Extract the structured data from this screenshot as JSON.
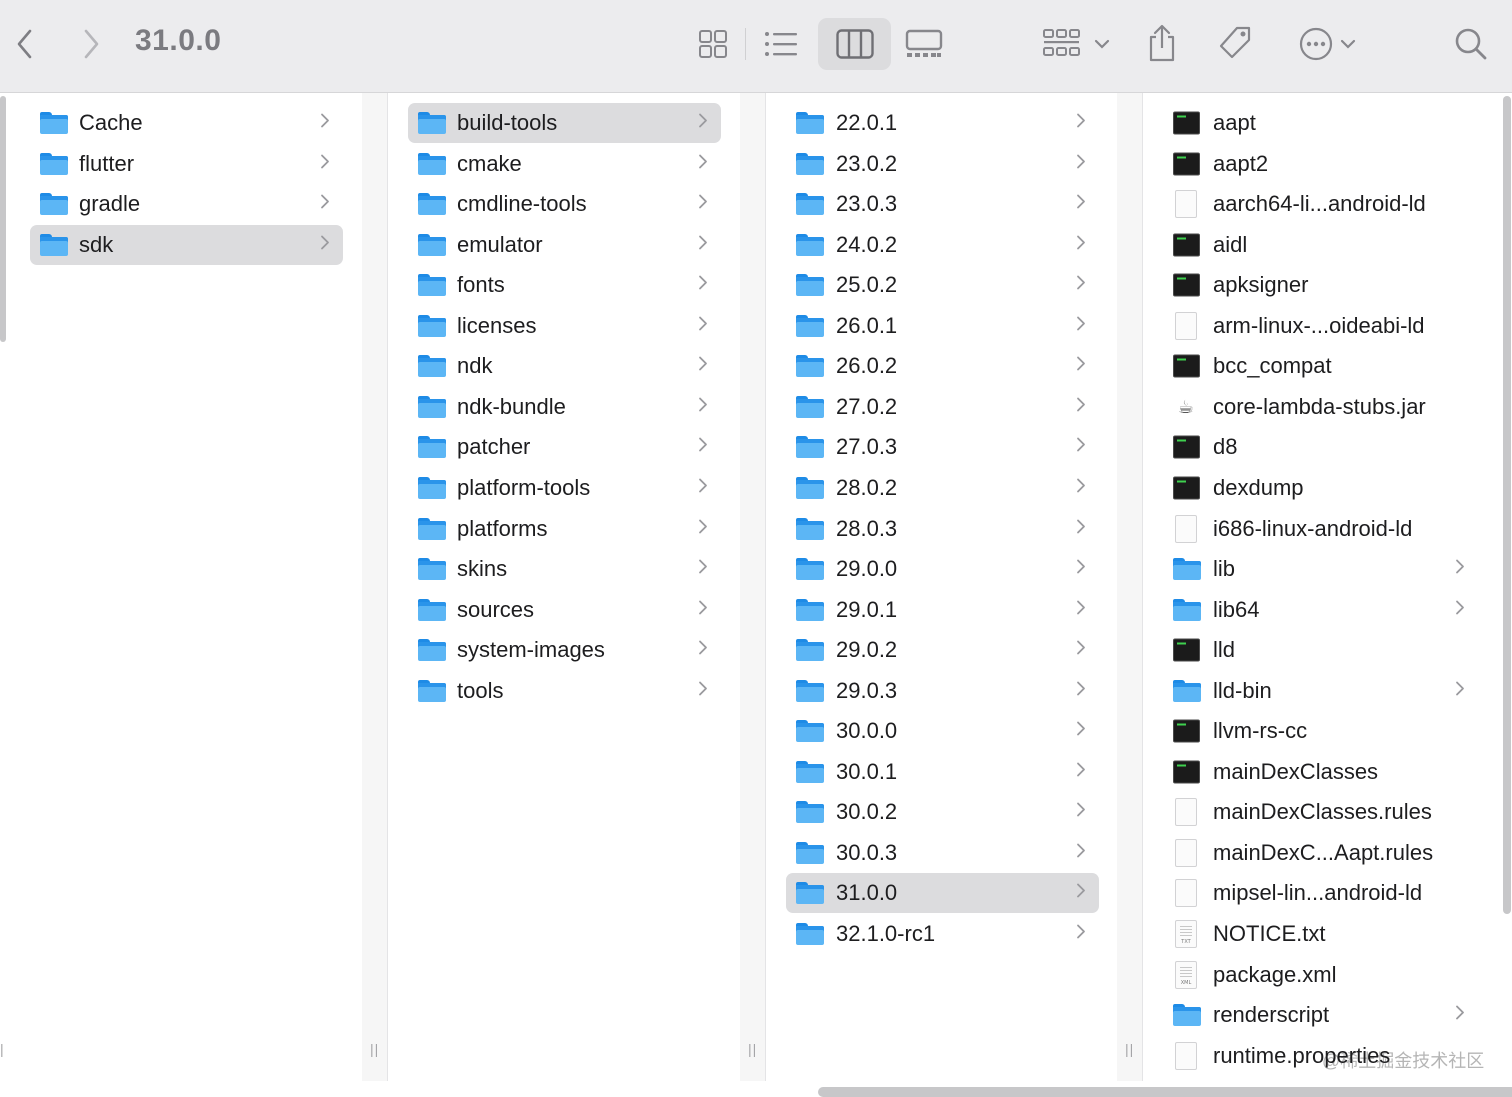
{
  "window": {
    "title": "31.0.0"
  },
  "toolbar": {
    "nav": [
      "back-icon",
      "forward-icon"
    ],
    "views": [
      "icon-view-icon",
      "list-view-icon",
      "column-view-icon",
      "gallery-view-icon"
    ],
    "active_view": "column-view-icon",
    "actions": [
      "group-icon",
      "share-icon",
      "tag-icon",
      "more-icon",
      "search-icon"
    ]
  },
  "columns": [
    {
      "items": [
        {
          "name": "Cache",
          "kind": "folder",
          "chevron": true
        },
        {
          "name": "flutter",
          "kind": "folder",
          "chevron": true
        },
        {
          "name": "gradle",
          "kind": "folder",
          "chevron": true
        },
        {
          "name": "sdk",
          "kind": "folder",
          "chevron": true,
          "selected": true
        }
      ]
    },
    {
      "items": [
        {
          "name": "build-tools",
          "kind": "folder",
          "chevron": true,
          "selected": true
        },
        {
          "name": "cmake",
          "kind": "folder",
          "chevron": true
        },
        {
          "name": "cmdline-tools",
          "kind": "folder",
          "chevron": true
        },
        {
          "name": "emulator",
          "kind": "folder",
          "chevron": true
        },
        {
          "name": "fonts",
          "kind": "folder",
          "chevron": true
        },
        {
          "name": "licenses",
          "kind": "folder",
          "chevron": true
        },
        {
          "name": "ndk",
          "kind": "folder",
          "chevron": true
        },
        {
          "name": "ndk-bundle",
          "kind": "folder",
          "chevron": true
        },
        {
          "name": "patcher",
          "kind": "folder",
          "chevron": true
        },
        {
          "name": "platform-tools",
          "kind": "folder",
          "chevron": true
        },
        {
          "name": "platforms",
          "kind": "folder",
          "chevron": true
        },
        {
          "name": "skins",
          "kind": "folder",
          "chevron": true
        },
        {
          "name": "sources",
          "kind": "folder",
          "chevron": true
        },
        {
          "name": "system-images",
          "kind": "folder",
          "chevron": true
        },
        {
          "name": "tools",
          "kind": "folder",
          "chevron": true
        }
      ]
    },
    {
      "items": [
        {
          "name": "22.0.1",
          "kind": "folder",
          "chevron": true
        },
        {
          "name": "23.0.2",
          "kind": "folder",
          "chevron": true
        },
        {
          "name": "23.0.3",
          "kind": "folder",
          "chevron": true
        },
        {
          "name": "24.0.2",
          "kind": "folder",
          "chevron": true
        },
        {
          "name": "25.0.2",
          "kind": "folder",
          "chevron": true
        },
        {
          "name": "26.0.1",
          "kind": "folder",
          "chevron": true
        },
        {
          "name": "26.0.2",
          "kind": "folder",
          "chevron": true
        },
        {
          "name": "27.0.2",
          "kind": "folder",
          "chevron": true
        },
        {
          "name": "27.0.3",
          "kind": "folder",
          "chevron": true
        },
        {
          "name": "28.0.2",
          "kind": "folder",
          "chevron": true
        },
        {
          "name": "28.0.3",
          "kind": "folder",
          "chevron": true
        },
        {
          "name": "29.0.0",
          "kind": "folder",
          "chevron": true
        },
        {
          "name": "29.0.1",
          "kind": "folder",
          "chevron": true
        },
        {
          "name": "29.0.2",
          "kind": "folder",
          "chevron": true
        },
        {
          "name": "29.0.3",
          "kind": "folder",
          "chevron": true
        },
        {
          "name": "30.0.0",
          "kind": "folder",
          "chevron": true
        },
        {
          "name": "30.0.1",
          "kind": "folder",
          "chevron": true
        },
        {
          "name": "30.0.2",
          "kind": "folder",
          "chevron": true
        },
        {
          "name": "30.0.3",
          "kind": "folder",
          "chevron": true
        },
        {
          "name": "31.0.0",
          "kind": "folder",
          "chevron": true,
          "selected": true
        },
        {
          "name": "32.1.0-rc1",
          "kind": "folder",
          "chevron": true
        }
      ]
    },
    {
      "items": [
        {
          "name": "aapt",
          "kind": "exec"
        },
        {
          "name": "aapt2",
          "kind": "exec"
        },
        {
          "name": "aarch64-li...android-ld",
          "kind": "doc"
        },
        {
          "name": "aidl",
          "kind": "exec"
        },
        {
          "name": "apksigner",
          "kind": "exec"
        },
        {
          "name": "arm-linux-...oideabi-ld",
          "kind": "doc"
        },
        {
          "name": "bcc_compat",
          "kind": "exec"
        },
        {
          "name": "core-lambda-stubs.jar",
          "kind": "jar"
        },
        {
          "name": "d8",
          "kind": "exec"
        },
        {
          "name": "dexdump",
          "kind": "exec"
        },
        {
          "name": "i686-linux-android-ld",
          "kind": "doc"
        },
        {
          "name": "lib",
          "kind": "folder",
          "chevron": true
        },
        {
          "name": "lib64",
          "kind": "folder",
          "chevron": true
        },
        {
          "name": "lld",
          "kind": "exec"
        },
        {
          "name": "lld-bin",
          "kind": "folder",
          "chevron": true
        },
        {
          "name": "llvm-rs-cc",
          "kind": "exec"
        },
        {
          "name": "mainDexClasses",
          "kind": "exec"
        },
        {
          "name": "mainDexClasses.rules",
          "kind": "doc"
        },
        {
          "name": "mainDexC...Aapt.rules",
          "kind": "doc"
        },
        {
          "name": "mipsel-lin...android-ld",
          "kind": "doc"
        },
        {
          "name": "NOTICE.txt",
          "kind": "txt",
          "tag": "TXT"
        },
        {
          "name": "package.xml",
          "kind": "txt",
          "tag": "XML"
        },
        {
          "name": "renderscript",
          "kind": "folder",
          "chevron": true
        },
        {
          "name": "runtime.properties",
          "kind": "doc"
        }
      ]
    }
  ],
  "watermark": "@稀土掘金技术社区"
}
